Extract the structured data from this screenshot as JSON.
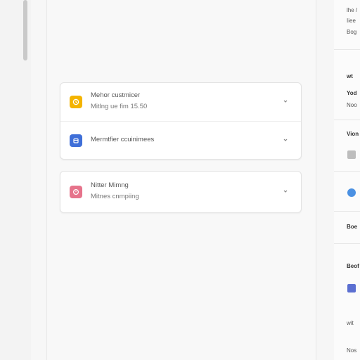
{
  "cards": {
    "first": {
      "rows": [
        {
          "title": "Mehor custmicer",
          "subtitle": "Mitlng ue fim 15.50",
          "icon": "clock-icon",
          "icon_color": "#f4b400"
        },
        {
          "title": "Mermtfier ccuinimees",
          "subtitle": "",
          "icon": "calendar-icon",
          "icon_color": "#3f6fd8"
        }
      ]
    },
    "second": {
      "rows": [
        {
          "title": "Nitter Mimng",
          "subtitle": "Mitnes cnmpiing",
          "icon": "alarm-icon",
          "icon_color": "#e6738b"
        }
      ]
    }
  },
  "right_panel": {
    "items": [
      {
        "label": "lhe /"
      },
      {
        "label": "Iiee"
      },
      {
        "label": "Bog"
      },
      {
        "label": "wt"
      },
      {
        "label": "Yod"
      },
      {
        "label": "Noo"
      },
      {
        "label": "Vion"
      },
      {
        "label": "Boe"
      },
      {
        "label": "Beof"
      },
      {
        "label": "wit"
      },
      {
        "label": "Nos"
      }
    ],
    "icon_colors": [
      "#bdbdbd",
      "#4a90e2",
      "#5b6fd1"
    ]
  }
}
